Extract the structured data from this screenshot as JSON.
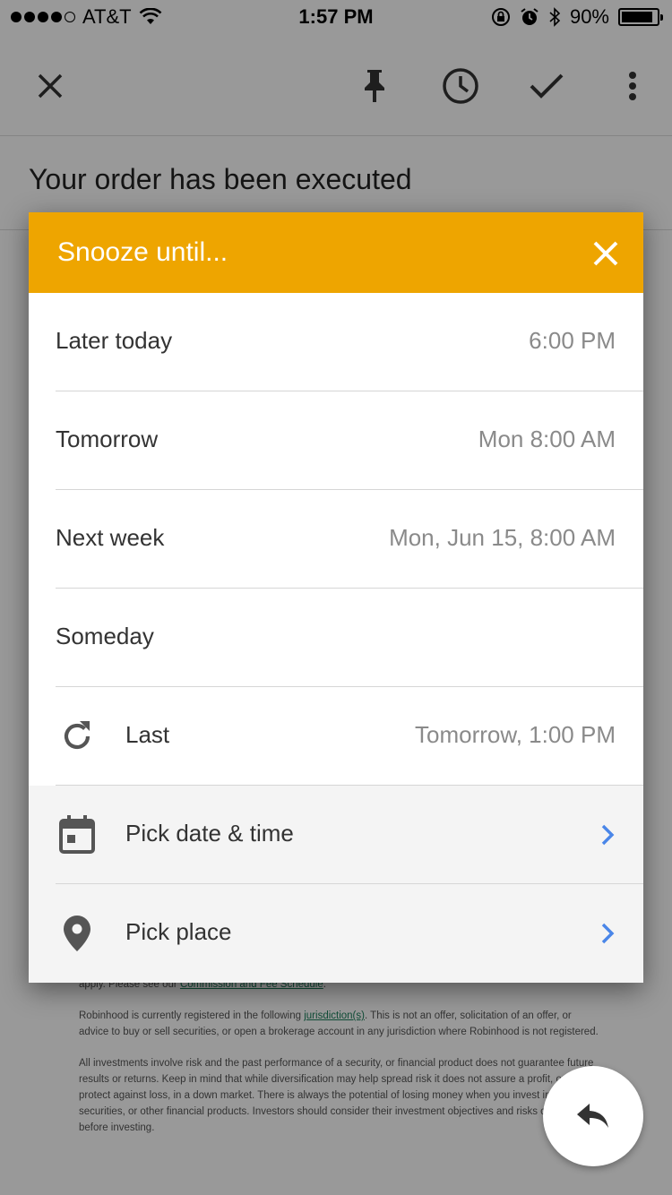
{
  "status_bar": {
    "carrier": "AT&T",
    "time": "1:57 PM",
    "battery": "90%",
    "battery_level": 0.9
  },
  "toolbar": {
    "icons": [
      "close-icon",
      "pin-icon",
      "clock-icon",
      "check-icon",
      "more-vert-icon"
    ]
  },
  "email": {
    "subject": "Your order has been executed",
    "disclaimer": {
      "p1_tail": "apply. Please see our ",
      "p1_link": "Commission and Fee Schedule",
      "p1_end": ".",
      "p2_start": "Robinhood is currently registered in the following ",
      "p2_link": "jurisdiction(s)",
      "p2_end": ". This is not an offer, solicitation of an offer, or advice to buy or sell securities, or open a brokerage account in any jurisdiction where Robinhood is not registered.",
      "p3": "All investments involve risk and the past performance of a security, or financial product does not guarantee future results or returns. Keep in mind that while diversification may help spread risk it does not assure a profit, or protect against loss, in a down market. There is always the potential of losing money when you invest in securities, or other financial products. Investors should consider their investment objectives and risks carefully before investing."
    }
  },
  "dialog": {
    "title": "Snooze until...",
    "options": [
      {
        "label": "Later today",
        "value": "6:00 PM"
      },
      {
        "label": "Tomorrow",
        "value": "Mon 8:00 AM"
      },
      {
        "label": "Next week",
        "value": "Mon, Jun 15, 8:00 AM"
      },
      {
        "label": "Someday",
        "value": ""
      },
      {
        "label": "Last",
        "value": "Tomorrow, 1:00 PM",
        "icon": "refresh-icon"
      },
      {
        "label": "Pick date & time",
        "value": "",
        "icon": "calendar-icon"
      },
      {
        "label": "Pick place",
        "value": "",
        "icon": "location-pin-icon"
      }
    ]
  },
  "fab": {
    "icon": "reply-icon"
  },
  "colors": {
    "header": "#eea500",
    "chevron": "#4a86e8"
  }
}
